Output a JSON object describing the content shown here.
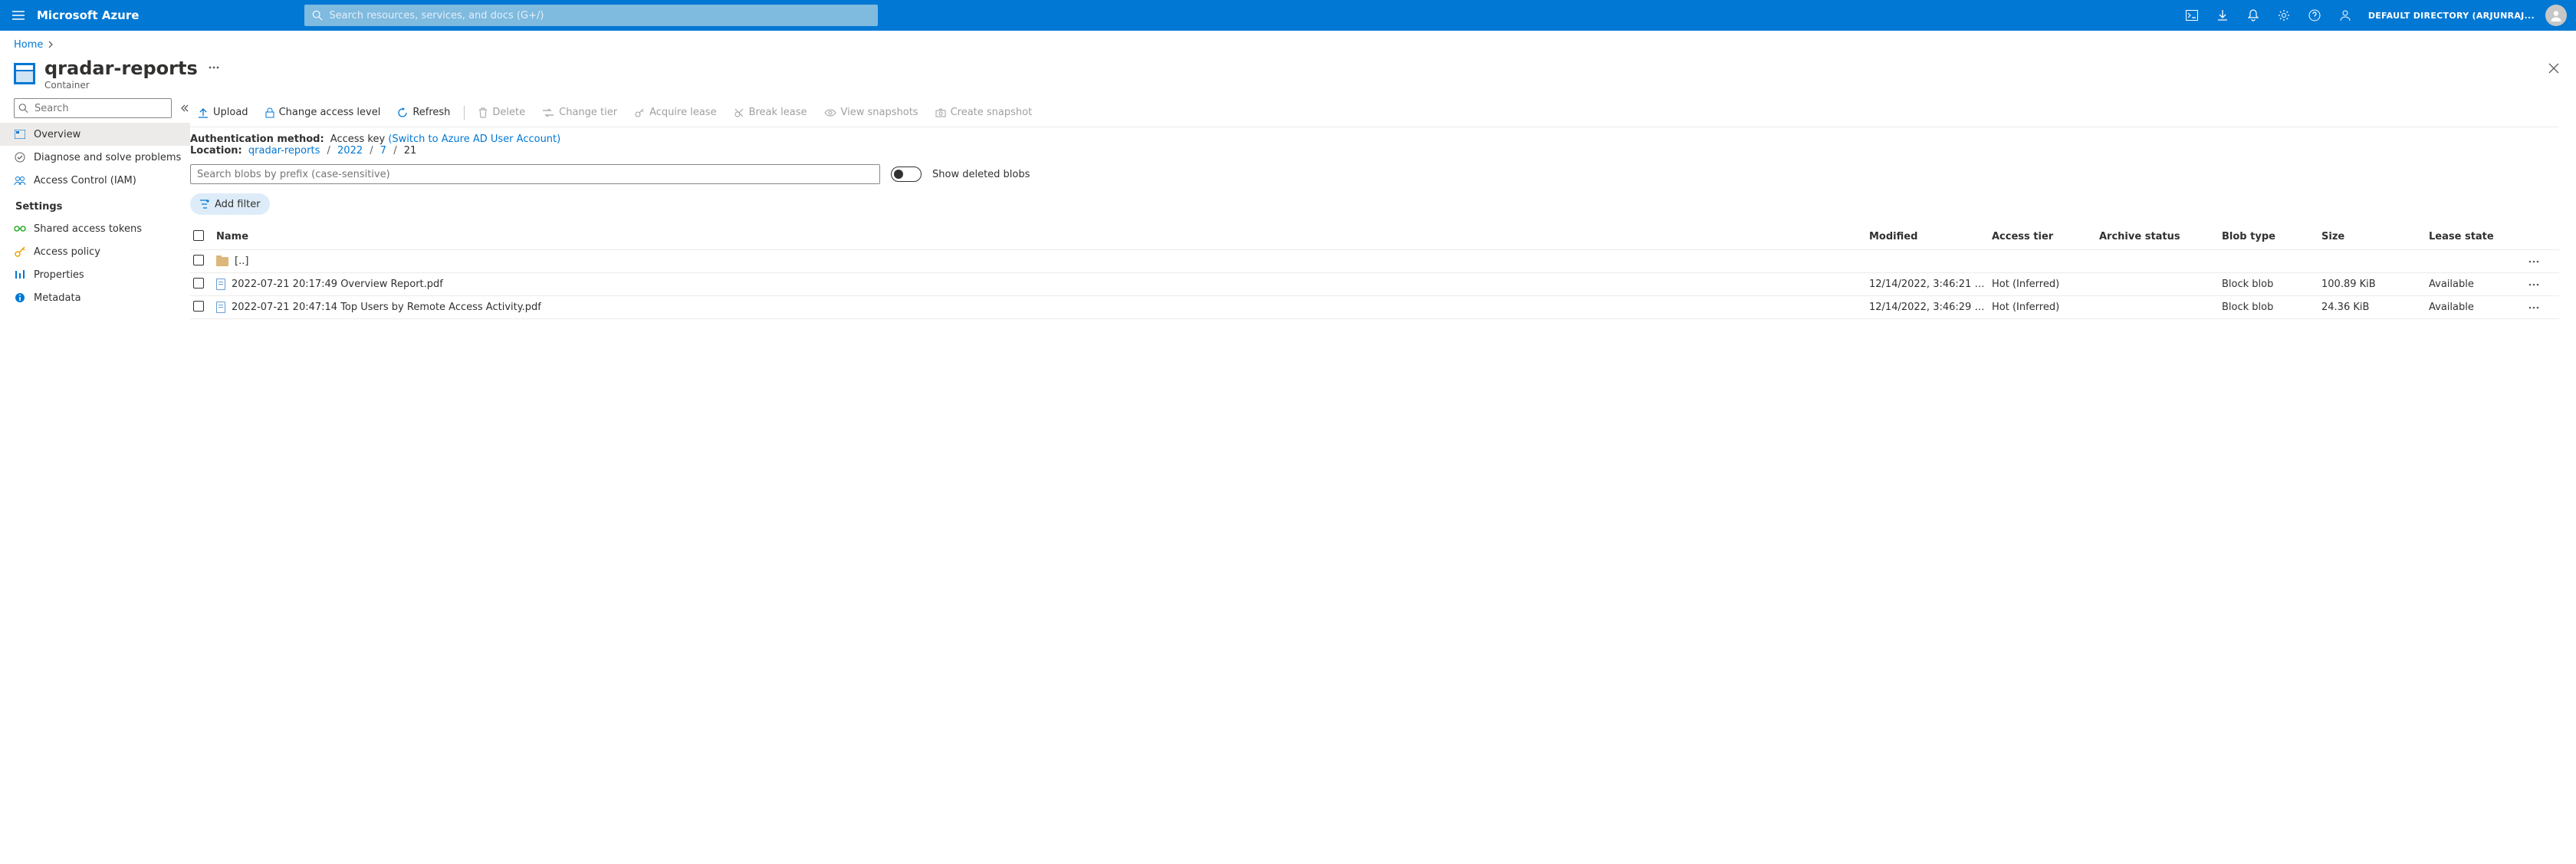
{
  "brand": "Microsoft Azure",
  "top_search_placeholder": "Search resources, services, and docs (G+/)",
  "directory_label": "DEFAULT DIRECTORY (ARJUNRAJ...",
  "breadcrumb": {
    "home": "Home"
  },
  "page": {
    "title": "qradar-reports",
    "subtitle": "Container"
  },
  "side_search_placeholder": "Search",
  "sidebar": {
    "items": [
      {
        "label": "Overview"
      },
      {
        "label": "Diagnose and solve problems"
      },
      {
        "label": "Access Control (IAM)"
      }
    ],
    "settings_heading": "Settings",
    "settings": [
      {
        "label": "Shared access tokens"
      },
      {
        "label": "Access policy"
      },
      {
        "label": "Properties"
      },
      {
        "label": "Metadata"
      }
    ]
  },
  "toolbar": {
    "upload": "Upload",
    "change_access": "Change access level",
    "refresh": "Refresh",
    "delete": "Delete",
    "change_tier": "Change tier",
    "acquire_lease": "Acquire lease",
    "break_lease": "Break lease",
    "view_snapshots": "View snapshots",
    "create_snapshot": "Create snapshot"
  },
  "info": {
    "auth_label": "Authentication method:",
    "auth_value": "Access key",
    "auth_link": "(Switch to Azure AD User Account)",
    "location_label": "Location:",
    "loc_root": "qradar-reports",
    "loc_1": "2022",
    "loc_2": "7",
    "loc_3": "21"
  },
  "prefix_placeholder": "Search blobs by prefix (case-sensitive)",
  "toggle_label": "Show deleted blobs",
  "add_filter": "Add filter",
  "columns": {
    "name": "Name",
    "modified": "Modified",
    "access_tier": "Access tier",
    "archive_status": "Archive status",
    "blob_type": "Blob type",
    "size": "Size",
    "lease_state": "Lease state"
  },
  "up_dir": "[..]",
  "rows": [
    {
      "name": "2022-07-21 20:17:49 Overview Report.pdf",
      "modified": "12/14/2022, 3:46:21 PM",
      "access_tier": "Hot (Inferred)",
      "archive_status": "",
      "blob_type": "Block blob",
      "size": "100.89 KiB",
      "lease_state": "Available"
    },
    {
      "name": "2022-07-21 20:47:14 Top Users by Remote Access Activity.pdf",
      "modified": "12/14/2022, 3:46:29 PM",
      "access_tier": "Hot (Inferred)",
      "archive_status": "",
      "blob_type": "Block blob",
      "size": "24.36 KiB",
      "lease_state": "Available"
    }
  ]
}
